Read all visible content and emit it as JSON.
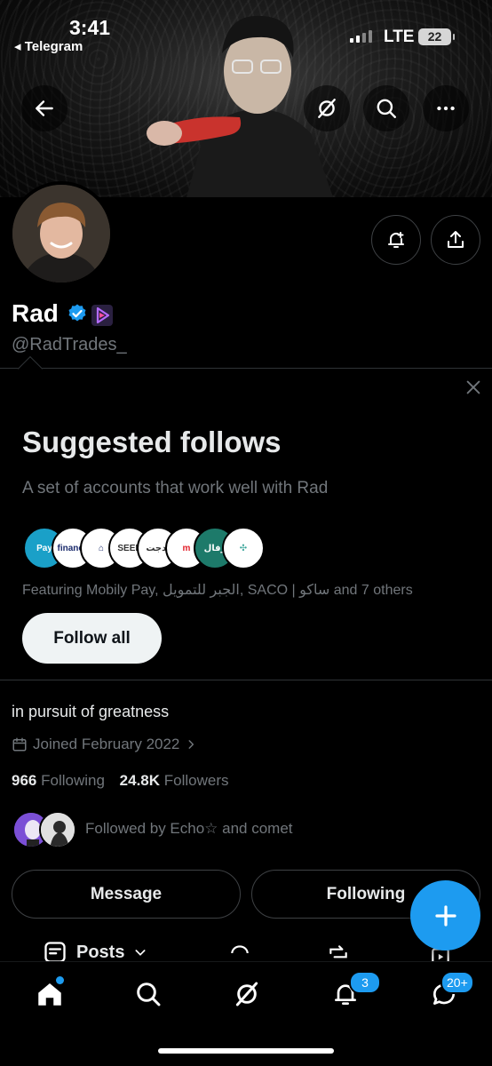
{
  "status_bar": {
    "time": "3:41",
    "back_app": "◂ Telegram",
    "network": "LTE",
    "battery": "22"
  },
  "header": {
    "back_icon": "arrow-left-icon",
    "grok_icon": "grok-icon",
    "search_icon": "search-icon",
    "more_icon": "more-horizontal-icon"
  },
  "profile": {
    "name": "Rad",
    "handle": "@RadTrades_",
    "bio": "in pursuit of greatness",
    "joined": "Joined February 2022",
    "following_count": "966",
    "following_label": "Following",
    "followers_count": "24.8K",
    "followers_label": "Followers",
    "followed_by": "Followed by Echo☆ and comet"
  },
  "suggested": {
    "title": "Suggested follows",
    "subtitle": "A set of accounts that work well with Rad",
    "featuring": "Featuring Mobily Pay, الجبر للتمويل, SACO | ساكو and 7 others",
    "follow_all": "Follow all",
    "logos": [
      {
        "name": "Mobily Pay",
        "text": "Pay",
        "bg": "#1aa0c8",
        "fg": "#ffffff"
      },
      {
        "name": "Aljabr Finance",
        "text": "finance",
        "bg": "#ffffff",
        "fg": "#1a2a6c"
      },
      {
        "name": "SACO",
        "text": "⌂",
        "bg": "#ffffff",
        "fg": "#1a2a6c"
      },
      {
        "name": "SEER",
        "text": "SEER",
        "bg": "#ffffff",
        "fg": "#333333"
      },
      {
        "name": "Bidaya",
        "text": "بدجت",
        "bg": "#ffffff",
        "fg": "#333333"
      },
      {
        "name": "Red",
        "text": "m",
        "bg": "#ffffff",
        "fg": "#e2202a"
      },
      {
        "name": "Green",
        "text": "رفال",
        "bg": "#1d7a6a",
        "fg": "#ffffff"
      },
      {
        "name": "Teal",
        "text": "✣",
        "bg": "#ffffff",
        "fg": "#3aa59a"
      }
    ]
  },
  "actions": {
    "message": "Message",
    "following": "Following"
  },
  "tabs": {
    "posts": "Posts"
  },
  "nav": {
    "notifications_badge": "3",
    "messages_badge": "20+"
  },
  "colors": {
    "accent": "#1d9bf0",
    "muted": "#71767b"
  }
}
